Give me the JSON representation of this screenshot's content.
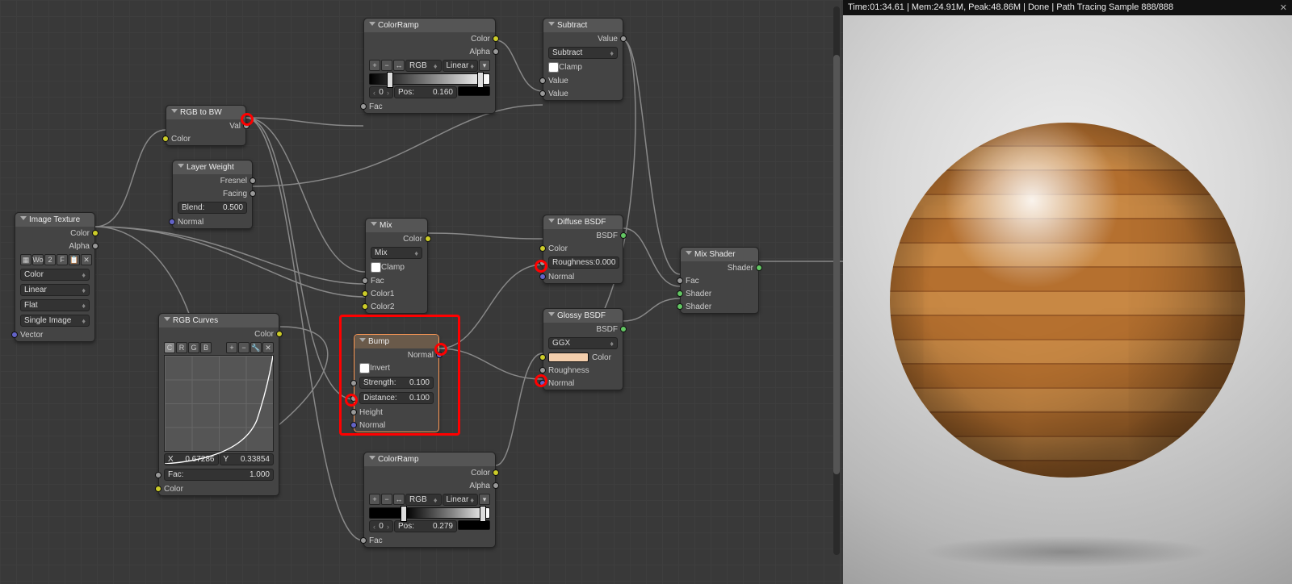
{
  "status_bar": "Time:01:34.61 | Mem:24.91M, Peak:48.86M | Done | Path Tracing Sample 888/888",
  "nodes": {
    "image_texture": {
      "title": "Image Texture",
      "out_color": "Color",
      "out_alpha": "Alpha",
      "tex_name": "Wo",
      "btn_2": "2",
      "btn_f": "F",
      "color_space": "Color",
      "interp": "Linear",
      "proj": "Flat",
      "source": "Single Image",
      "in_vector": "Vector"
    },
    "rgb_to_bw": {
      "title": "RGB to BW",
      "out_val": "Val",
      "in_color": "Color"
    },
    "layer_weight": {
      "title": "Layer Weight",
      "out_fresnel": "Fresnel",
      "out_facing": "Facing",
      "blend_lbl": "Blend:",
      "blend": "0.500",
      "in_normal": "Normal"
    },
    "rgb_curves": {
      "title": "RGB Curves",
      "out_color": "Color",
      "tabs": [
        "C",
        "R",
        "G",
        "B"
      ],
      "x_lbl": "X",
      "x": "0.67286",
      "y_lbl": "Y",
      "y": "0.33854",
      "fac_lbl": "Fac:",
      "fac": "1.000",
      "in_color": "Color"
    },
    "colorramp1": {
      "title": "ColorRamp",
      "out_color": "Color",
      "out_alpha": "Alpha",
      "mode": "RGB",
      "interp": "Linear",
      "idx": "0",
      "pos_lbl": "Pos:",
      "pos": "0.160",
      "in_fac": "Fac"
    },
    "colorramp2": {
      "title": "ColorRamp",
      "out_color": "Color",
      "out_alpha": "Alpha",
      "mode": "RGB",
      "interp": "Linear",
      "idx": "0",
      "pos_lbl": "Pos:",
      "pos": "0.279",
      "in_fac": "Fac"
    },
    "mix": {
      "title": "Mix",
      "out_color": "Color",
      "type": "Mix",
      "clamp": "Clamp",
      "in_fac": "Fac",
      "in_c1": "Color1",
      "in_c2": "Color2"
    },
    "bump": {
      "title": "Bump",
      "out_normal": "Normal",
      "invert": "Invert",
      "str_lbl": "Strength:",
      "str": "0.100",
      "dist_lbl": "Distance:",
      "dist": "0.100",
      "in_height": "Height",
      "in_normal": "Normal"
    },
    "subtract": {
      "title": "Subtract",
      "out_value": "Value",
      "op": "Subtract",
      "clamp": "Clamp",
      "in_v1": "Value",
      "in_v2": "Value"
    },
    "diffuse": {
      "title": "Diffuse BSDF",
      "out": "BSDF",
      "in_color": "Color",
      "rough_lbl": "Roughness:",
      "rough": "0.000",
      "in_normal": "Normal"
    },
    "glossy": {
      "title": "Glossy BSDF",
      "out": "BSDF",
      "dist": "GGX",
      "in_color": "Color",
      "in_rough": "Roughness",
      "in_normal": "Normal"
    },
    "mix_shader": {
      "title": "Mix Shader",
      "out": "Shader",
      "in_fac": "Fac",
      "in_s1": "Shader",
      "in_s2": "Shader"
    }
  }
}
